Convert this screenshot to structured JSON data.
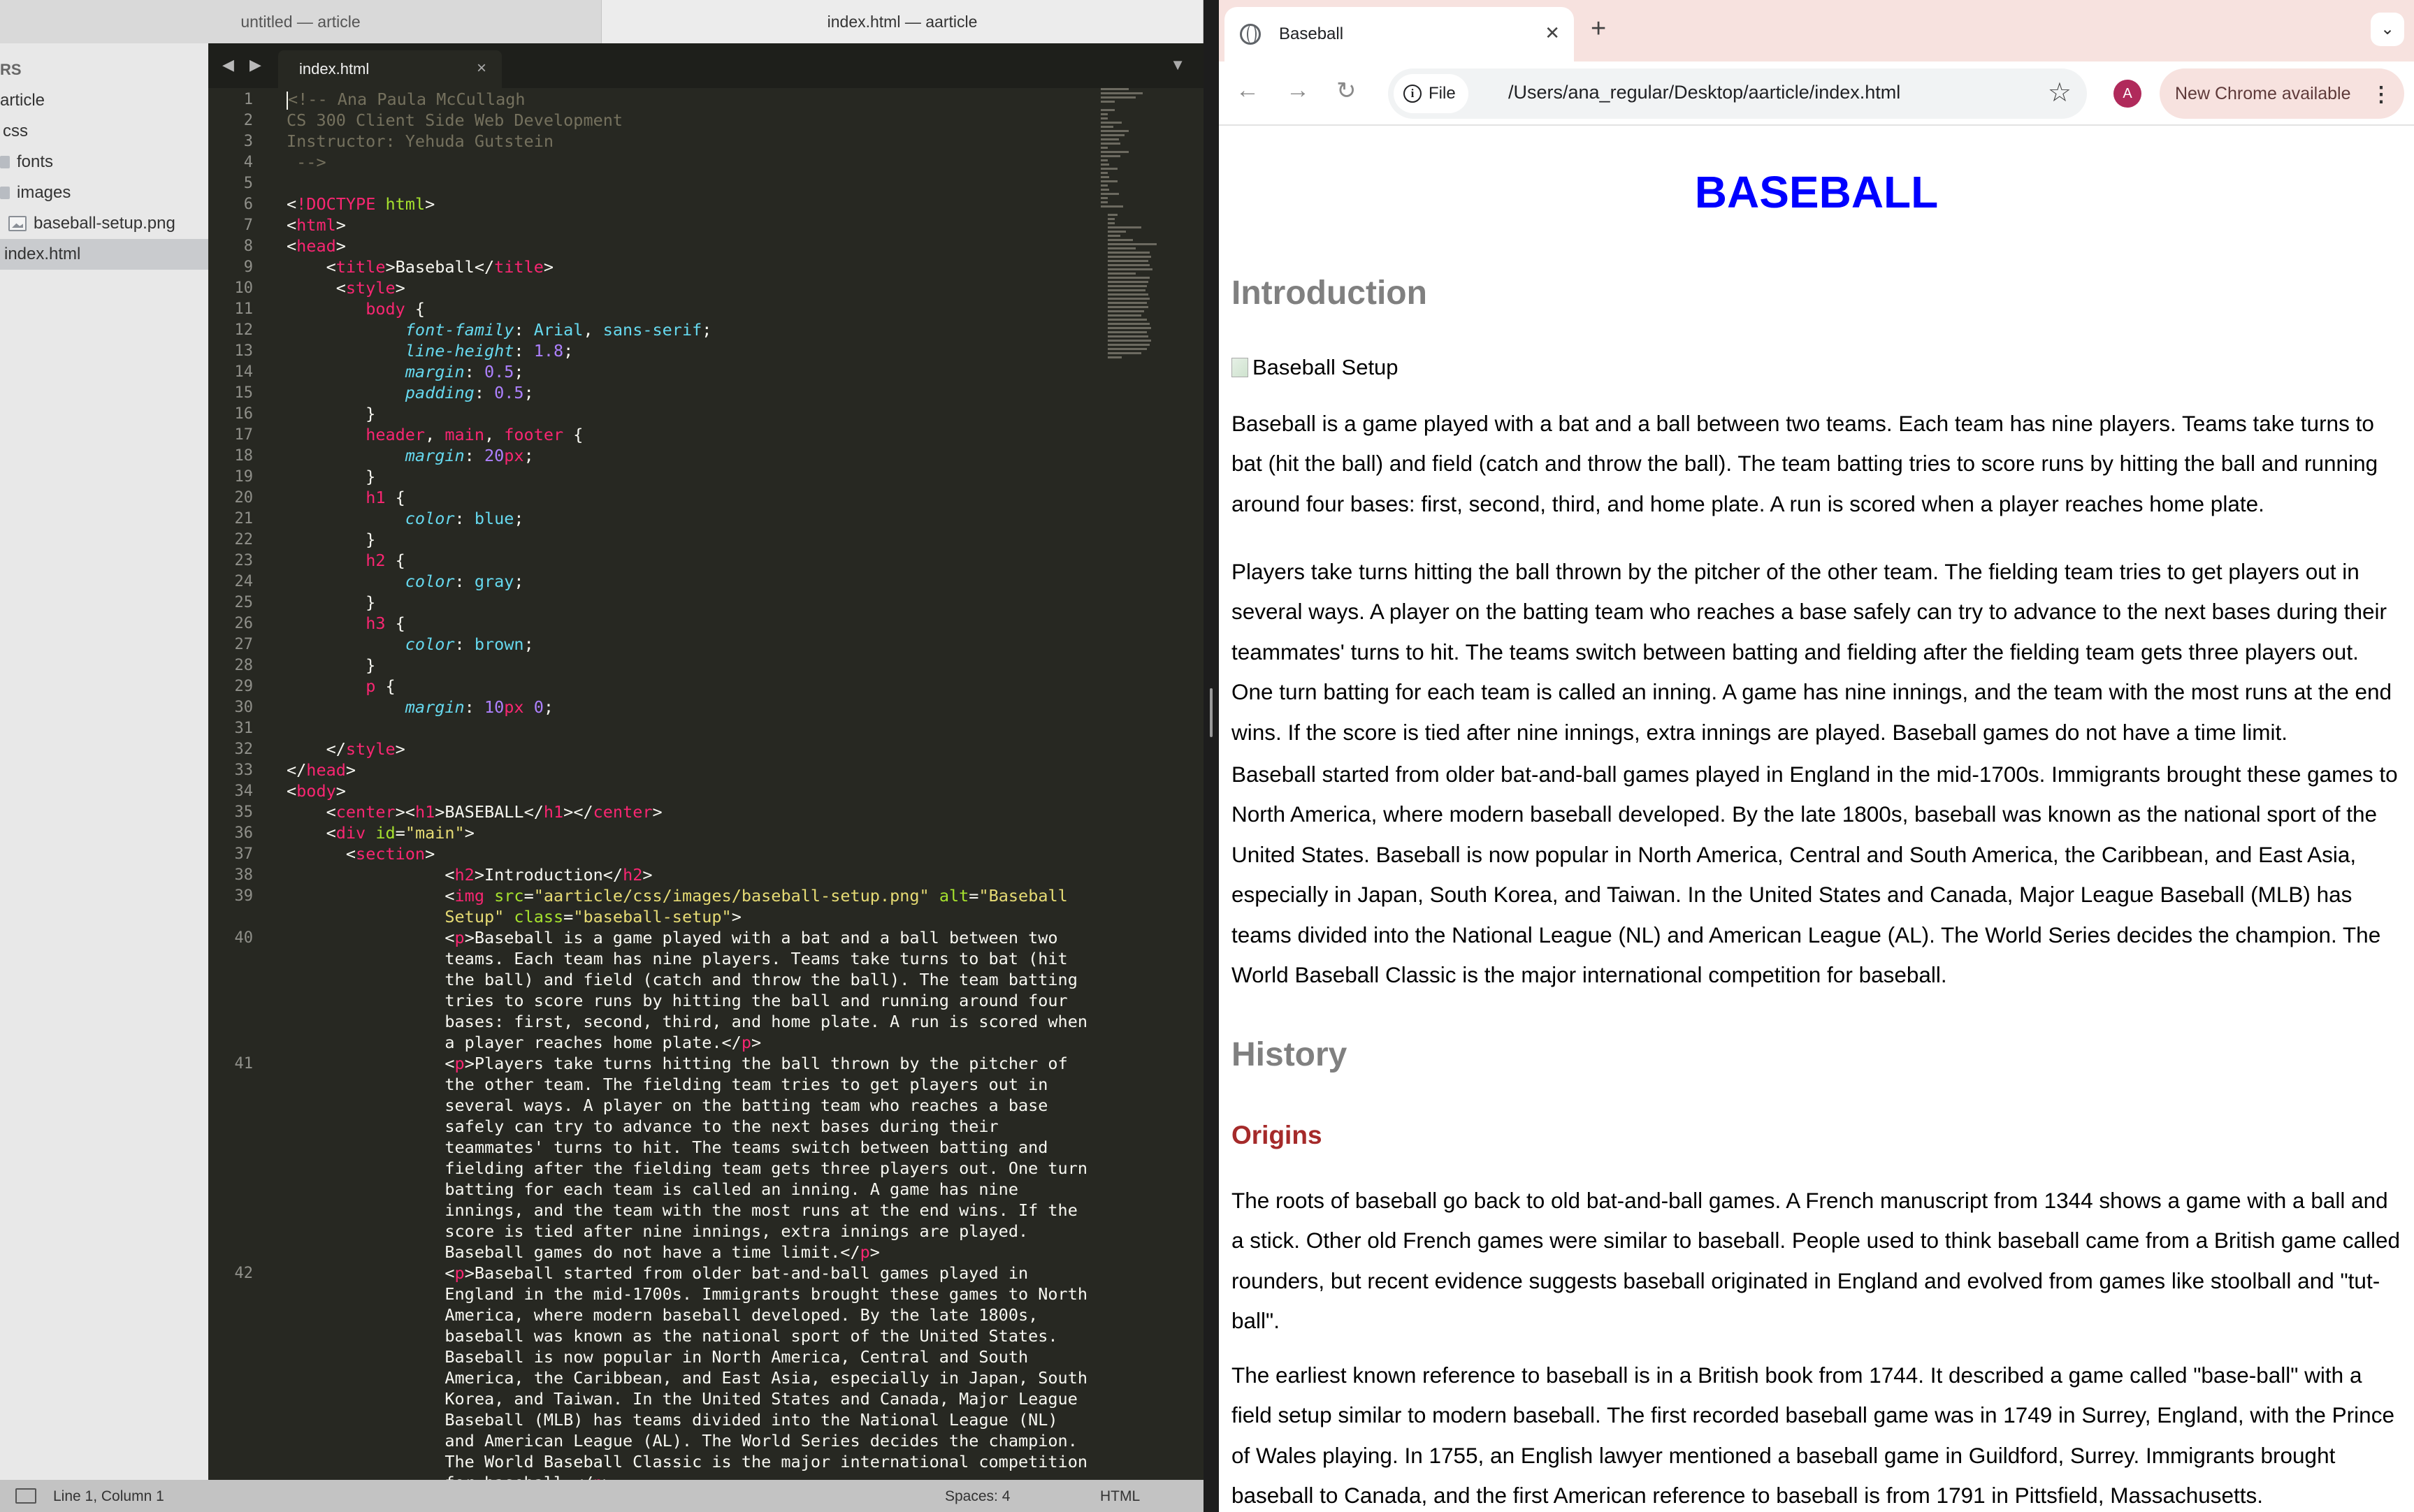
{
  "editor": {
    "window_tabs": [
      "untitled — article",
      "index.html — aarticle"
    ],
    "sidebar": {
      "header": "RS",
      "items": [
        {
          "label": "article",
          "kind": "folder"
        },
        {
          "label": "css",
          "kind": "folder"
        },
        {
          "label": "fonts",
          "kind": "folder"
        },
        {
          "label": "images",
          "kind": "folder"
        },
        {
          "label": "baseball-setup.png",
          "kind": "image"
        },
        {
          "label": "index.html",
          "kind": "file",
          "selected": true
        }
      ]
    },
    "tab": {
      "label": "index.html",
      "close": "×"
    },
    "nav": "◀ ▶",
    "tab_menu": "▼",
    "line_numbers": [
      "1",
      "2",
      "3",
      "4",
      "5",
      "6",
      "7",
      "8",
      "9",
      "10",
      "11",
      "12",
      "13",
      "14",
      "15",
      "16",
      "17",
      "18",
      "19",
      "20",
      "21",
      "22",
      "23",
      "24",
      "25",
      "26",
      "27",
      "28",
      "29",
      "30",
      "31",
      "32",
      "33",
      "34",
      "35",
      "36",
      "37",
      "38",
      "39",
      "40",
      "41",
      "42"
    ],
    "status": {
      "position": "Line 1, Column 1",
      "spaces": "Spaces: 4",
      "syntax": "HTML"
    }
  },
  "browser": {
    "tab_title": "Baseball",
    "tab_close": "✕",
    "new_tab": "+",
    "tab_search": "⌄",
    "back": "←",
    "forward": "→",
    "reload": "↻",
    "site_chip": "File",
    "url": "/Users/ana_regular/Desktop/aarticle/index.html",
    "star": "☆",
    "avatar": "A",
    "update_chip": "New Chrome available",
    "menu": "⋮",
    "page": {
      "h1": "BASEBALL",
      "h2_intro": "Introduction",
      "img_alt": "Baseball Setup",
      "p1": "Baseball is a game played with a bat and a ball between two teams. Each team has nine players. Teams take turns to bat (hit the ball) and field (catch and throw the ball). The team batting tries to score runs by hitting the ball and running around four bases: first, second, third, and home plate. A run is scored when a player reaches home plate.",
      "p2": "Players take turns hitting the ball thrown by the pitcher of the other team. The fielding team tries to get players out in several ways. A player on the batting team who reaches a base safely can try to advance to the next bases during their teammates' turns to hit. The teams switch between batting and fielding after the fielding team gets three players out. One turn batting for each team is called an inning. A game has nine innings, and the team with the most runs at the end wins. If the score is tied after nine innings, extra innings are played. Baseball games do not have a time limit.",
      "p3": "Baseball started from older bat-and-ball games played in England in the mid-1700s. Immigrants brought these games to North America, where modern baseball developed. By the late 1800s, baseball was known as the national sport of the United States. Baseball is now popular in North America, Central and South America, the Caribbean, and East Asia, especially in Japan, South Korea, and Taiwan. In the United States and Canada, Major League Baseball (MLB) has teams divided into the National League (NL) and American League (AL). The World Series decides the champion. The World Baseball Classic is the major international competition for baseball.",
      "h2_history": "History",
      "h3_origins": "Origins",
      "p4": "The roots of baseball go back to old bat-and-ball games. A French manuscript from 1344 shows a game with a ball and a stick. Other old French games were similar to baseball. People used to think baseball came from a British game called rounders, but recent evidence suggests baseball originated in England and evolved from games like stoolball and \"tut-ball\".",
      "p5": "The earliest known reference to baseball is in a British book from 1744. It described a game called \"base-ball\" with a field setup similar to modern baseball. The first recorded baseball game was in 1749 in Surrey, England, with the Prince of Wales playing. In 1755, an English lawyer mentioned a baseball game in Guildford, Surrey. Immigrants brought baseball to Canada, and the first American reference to baseball is from 1791 in Pittsfield, Massachusetts."
    }
  }
}
